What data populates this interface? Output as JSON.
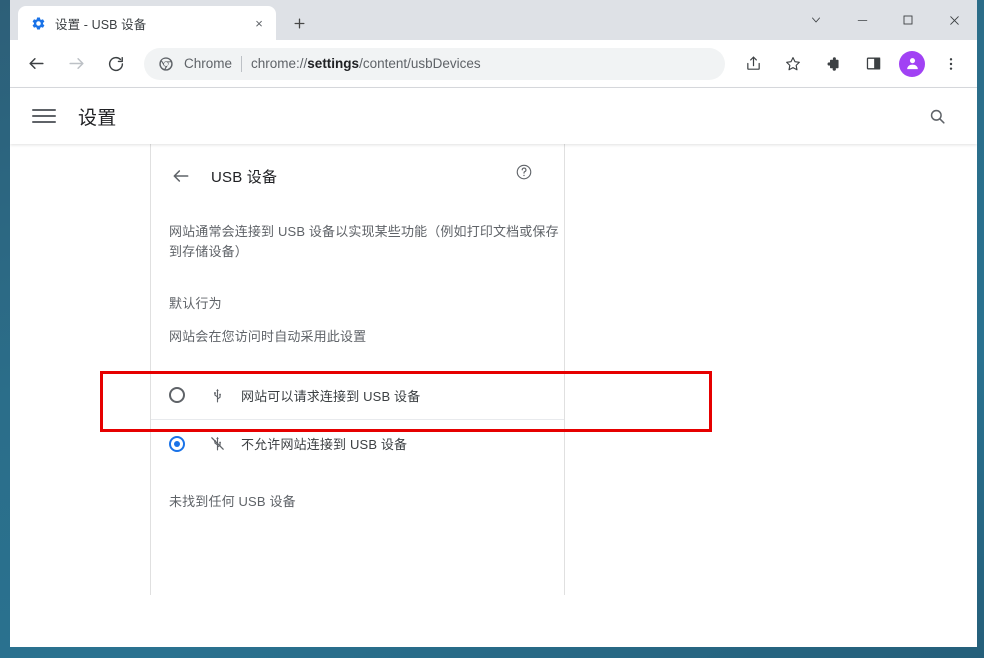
{
  "browser": {
    "tab": {
      "title": "设置 - USB 设备",
      "favicon": "gear-icon",
      "close_label": "×"
    },
    "new_tab_label": "+",
    "window_controls": {
      "tab_search": "tab-search-icon",
      "minimize": "minimize-icon",
      "maximize": "maximize-icon",
      "close": "close-icon"
    },
    "toolbar": {
      "back": "back-arrow-icon",
      "forward": "forward-arrow-icon",
      "reload": "reload-icon",
      "omnibox": {
        "icon": "chrome-logo-icon",
        "scheme_label": "Chrome",
        "url_prefix": "chrome://",
        "url_bold": "settings",
        "url_suffix": "/content/usbDevices"
      },
      "share": "share-icon",
      "bookmark": "star-icon",
      "extensions": "puzzle-icon",
      "side_panel": "side-panel-icon",
      "profile": "avatar-icon",
      "menu": "three-dot-menu-icon"
    }
  },
  "settings": {
    "menu_label": "hamburger-menu-icon",
    "title": "设置",
    "search_label": "search-icon"
  },
  "page": {
    "back_label": "back-arrow-icon",
    "title": "USB 设备",
    "help_label": "?",
    "description": "网站通常会连接到 USB 设备以实现某些功能（例如打印文档或保存到存储设备）",
    "section_heading": "默认行为",
    "section_subtitle": "网站会在您访问时自动采用此设置",
    "options": [
      {
        "label": "网站可以请求连接到 USB 设备",
        "icon": "usb-icon",
        "selected": false
      },
      {
        "label": "不允许网站连接到 USB 设备",
        "icon": "usb-off-icon",
        "selected": true
      }
    ],
    "empty_state": "未找到任何 USB 设备"
  },
  "colors": {
    "accent": "#1a73e8",
    "annotation": "#e60000",
    "tabstrip": "#dee1e6",
    "avatar": "#a142f4",
    "desktop": "#2b6e8a"
  }
}
